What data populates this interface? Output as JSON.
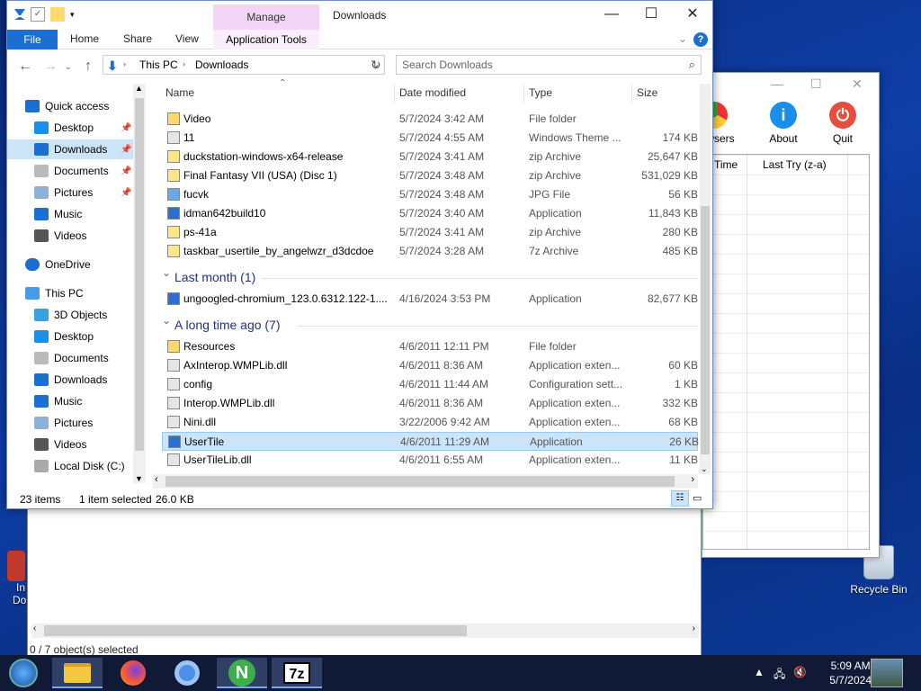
{
  "desktop": {
    "recycle_bin": "Recycle Bin",
    "left_icon_line1": "In",
    "left_icon_line2": "Do"
  },
  "app_window": {
    "toolbar": [
      {
        "label": "wsers",
        "icon": "browser-icon"
      },
      {
        "label": "About",
        "icon": "info-icon"
      },
      {
        "label": "Quit",
        "icon": "power-icon"
      }
    ],
    "columns": [
      "Time",
      "Last Try (z-a)"
    ]
  },
  "zip_window": {
    "status": "0 / 7 object(s) selected"
  },
  "explorer": {
    "title": "Downloads",
    "manage_tab": "Manage",
    "ribbon_tabs": [
      "File",
      "Home",
      "Share",
      "View",
      "Application Tools"
    ],
    "address": {
      "crumbs": [
        "This PC",
        "Downloads"
      ]
    },
    "search_placeholder": "Search Downloads",
    "sidebar": [
      {
        "label": "Quick access",
        "icon": "star-icon"
      },
      {
        "label": "Desktop",
        "icon": "desktop-icon",
        "pinned": true
      },
      {
        "label": "Downloads",
        "icon": "download-icon",
        "pinned": true,
        "selected": true
      },
      {
        "label": "Documents",
        "icon": "documents-icon",
        "pinned": true
      },
      {
        "label": "Pictures",
        "icon": "pictures-icon",
        "pinned": true
      },
      {
        "label": "Music",
        "icon": "music-icon"
      },
      {
        "label": "Videos",
        "icon": "videos-icon"
      },
      {
        "label": "OneDrive",
        "icon": "cloud-icon"
      },
      {
        "label": "This PC",
        "icon": "computer-icon"
      },
      {
        "label": "3D Objects",
        "icon": "cube-icon"
      },
      {
        "label": "Desktop",
        "icon": "desktop-icon"
      },
      {
        "label": "Documents",
        "icon": "documents-icon"
      },
      {
        "label": "Downloads",
        "icon": "download-icon"
      },
      {
        "label": "Music",
        "icon": "music-icon"
      },
      {
        "label": "Pictures",
        "icon": "pictures-icon"
      },
      {
        "label": "Videos",
        "icon": "videos-icon"
      },
      {
        "label": "Local Disk (C:)",
        "icon": "drive-icon"
      }
    ],
    "columns": [
      "Name",
      "Date modified",
      "Type",
      "Size"
    ],
    "groups": [
      {
        "label": "Last month (1)"
      },
      {
        "label": "A long time ago (7)"
      }
    ],
    "files": [
      {
        "name": "Video",
        "date": "5/7/2024 3:42 AM",
        "type": "File folder",
        "size": "",
        "icon": "folder-icon"
      },
      {
        "name": "11",
        "date": "5/7/2024 4:55 AM",
        "type": "Windows Theme ...",
        "size": "174 KB",
        "icon": "theme-icon"
      },
      {
        "name": "duckstation-windows-x64-release",
        "date": "5/7/2024 3:41 AM",
        "type": "zip Archive",
        "size": "25,647 KB",
        "icon": "zip-icon"
      },
      {
        "name": "Final Fantasy VII (USA) (Disc 1)",
        "date": "5/7/2024 3:48 AM",
        "type": "zip Archive",
        "size": "531,029 KB",
        "icon": "zip-icon"
      },
      {
        "name": "fucvk",
        "date": "5/7/2024 3:48 AM",
        "type": "JPG File",
        "size": "56 KB",
        "icon": "image-icon"
      },
      {
        "name": "idman642build10",
        "date": "5/7/2024 3:40 AM",
        "type": "Application",
        "size": "11,843 KB",
        "icon": "app-icon"
      },
      {
        "name": "ps-41a",
        "date": "5/7/2024 3:41 AM",
        "type": "zip Archive",
        "size": "280 KB",
        "icon": "zip-icon"
      },
      {
        "name": "taskbar_usertile_by_angelwzr_d3dcdoe",
        "date": "5/7/2024 3:28 AM",
        "type": "7z Archive",
        "size": "485 KB",
        "icon": "zip-icon"
      },
      {
        "name": "ungoogled-chromium_123.0.6312.122-1....",
        "date": "4/16/2024 3:53 PM",
        "type": "Application",
        "size": "82,677 KB",
        "icon": "app-icon"
      },
      {
        "name": "Resources",
        "date": "4/6/2011 12:11 PM",
        "type": "File folder",
        "size": "",
        "icon": "folder-icon"
      },
      {
        "name": "AxInterop.WMPLib.dll",
        "date": "4/6/2011 8:36 AM",
        "type": "Application exten...",
        "size": "60 KB",
        "icon": "dll-icon"
      },
      {
        "name": "config",
        "date": "4/6/2011 11:44 AM",
        "type": "Configuration sett...",
        "size": "1 KB",
        "icon": "config-icon"
      },
      {
        "name": "Interop.WMPLib.dll",
        "date": "4/6/2011 8:36 AM",
        "type": "Application exten...",
        "size": "332 KB",
        "icon": "dll-icon"
      },
      {
        "name": "Nini.dll",
        "date": "3/22/2006 9:42 AM",
        "type": "Application exten...",
        "size": "68 KB",
        "icon": "dll-icon"
      },
      {
        "name": "UserTile",
        "date": "4/6/2011 11:29 AM",
        "type": "Application",
        "size": "26 KB",
        "icon": "app-icon",
        "selected": true
      },
      {
        "name": "UserTileLib.dll",
        "date": "4/6/2011 6:55 AM",
        "type": "Application exten...",
        "size": "11 KB",
        "icon": "dll-icon"
      }
    ],
    "status": {
      "count": "23 items",
      "selected": "1 item selected",
      "size": "26.0 KB"
    }
  },
  "taskbar": {
    "items": [
      {
        "icon": "start-icon"
      },
      {
        "icon": "file-explorer-icon",
        "active": true
      },
      {
        "icon": "firefox-icon"
      },
      {
        "icon": "chromium-icon"
      },
      {
        "icon": "n-app-icon",
        "active": true
      },
      {
        "icon": "7zip-icon",
        "label": "7z",
        "active": true
      }
    ],
    "time": "5:09 AM",
    "date": "5/7/2024"
  }
}
